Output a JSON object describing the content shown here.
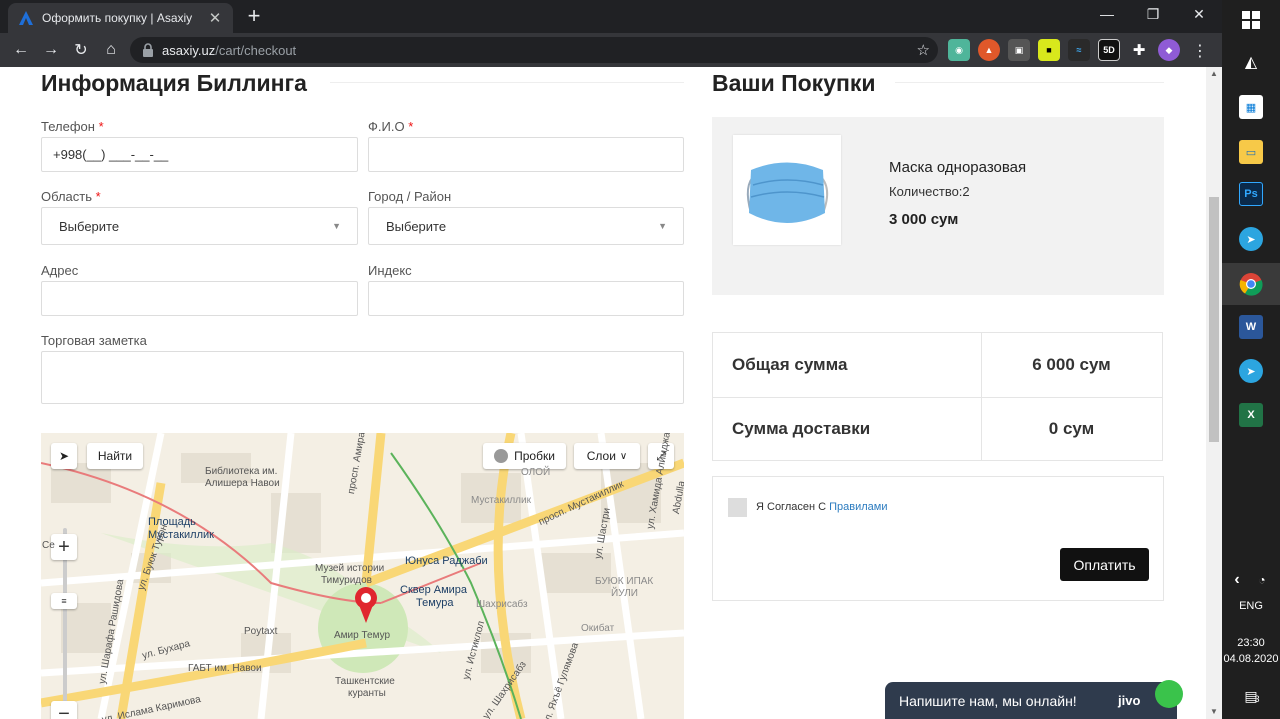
{
  "browser": {
    "tab_title": "Оформить покупку | Asaxiy",
    "url_host": "asaxiy.uz",
    "url_path": "/cart/checkout",
    "new_tab": "+",
    "tab_close": "✕"
  },
  "billing": {
    "title": "Информация Биллинга",
    "phone_label": "Телефон",
    "phone_value": "+998(__) ___-__-__",
    "fio_label": "Ф.И.О",
    "region_label": "Область",
    "region_value": "Выберите",
    "city_label": "Город / Район",
    "city_value": "Выберите",
    "address_label": "Адрес",
    "index_label": "Индекс",
    "note_label": "Торговая заметка",
    "required_mark": "*"
  },
  "map": {
    "find_button": "Найти",
    "traffic_button": "Пробки",
    "layers_button": "Слои",
    "labels": {
      "library": "Библиотека им.",
      "library2": "Алишера Навои",
      "square": "Площадь",
      "square2": "Мустакиллик",
      "museum": "Музей истории",
      "museum2": "Тимуридов",
      "yunus": "Юнуса Раджаби",
      "skver": "Сквер Амира",
      "skver2": "Темура",
      "amir": "Амир Темур",
      "poytaxt": "Poytaxt",
      "gabt": "ГАБТ им. Навои",
      "kuranty": "Ташкентские",
      "kuranty2": "куранты",
      "mustakillik": "Мустакиллик",
      "shakhrisabz": "Шахрисабз",
      "okibat": "Окибат",
      "buyuk": "БУЮК ИПАК",
      "yuli": "ЙУЛИ",
      "st_amir": "просп. Амира Темура",
      "st_must": "просп. Мустакиллик",
      "st_shastri": "ул. Шастри",
      "st_buxara": "ул. Бухара",
      "st_buyuk": "ул. Буюк Турон",
      "st_sharaf": "ул. Шарафа Рашидова",
      "st_islam": "ул. Ислама Каримова",
      "st_istiklol": "ул. Истиклол",
      "st_shakhr": "ул. Шахрисабз",
      "st_gulyam": "ул. Яхъё Гулямова",
      "st_abdulla": "Abdulla",
      "st_amin": "ул. Хамида Алимджана",
      "kolo": "Се",
      "oloy": "ОЛОЙ"
    }
  },
  "cart": {
    "title": "Ваши Покупки",
    "product_name": "Маска одноразовая",
    "product_qty": "Количество:2",
    "product_price": "3 000 сум",
    "total_label": "Общая сумма",
    "total_value": "6 000 сум",
    "delivery_label": "Сумма доставки",
    "delivery_value": "0 сум",
    "agree_text": "Я Согласен С",
    "agree_link": "Правилами",
    "pay_button": "Оплатить"
  },
  "jivo": {
    "text": "Напишите нам, мы онлайн!",
    "logo": "jivo"
  },
  "taskbar": {
    "lang": "ENG",
    "time": "23:30",
    "date": "04.08.2020",
    "notif_count": "3"
  }
}
